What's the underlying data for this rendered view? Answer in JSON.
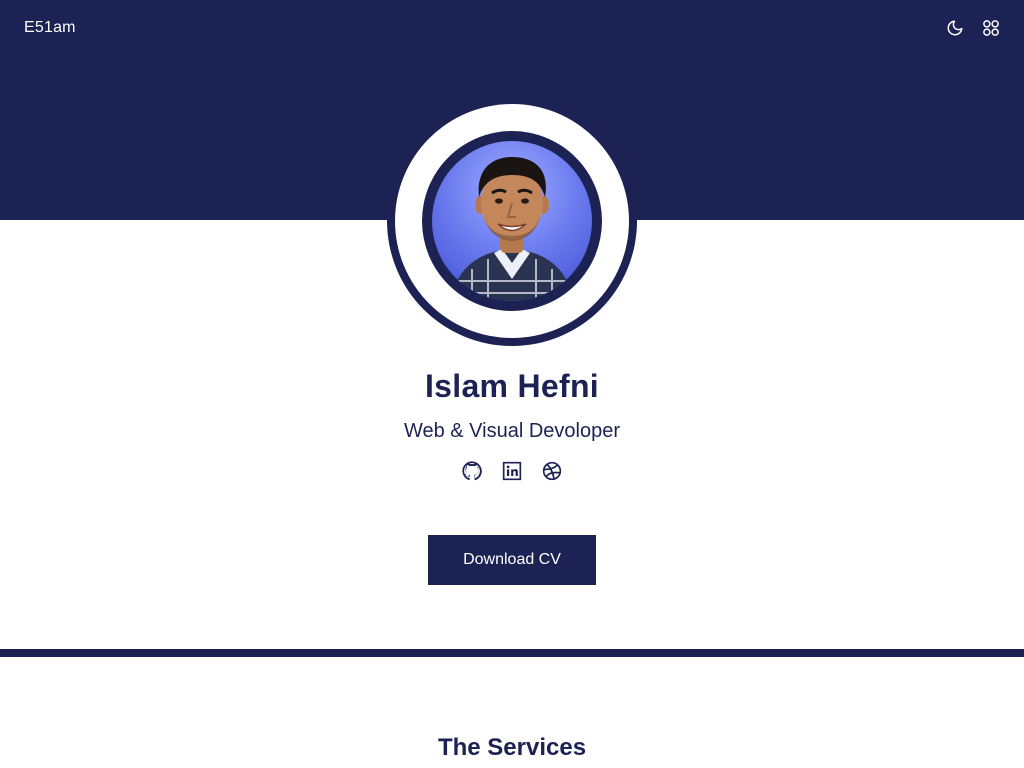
{
  "nav": {
    "logo": "E51am",
    "theme_icon": "moon-icon",
    "menu_icon": "grid-icon"
  },
  "profile": {
    "name": "Islam Hefni",
    "role": "Web & Visual Devoloper",
    "socials": [
      {
        "icon": "github-icon"
      },
      {
        "icon": "linkedin-icon"
      },
      {
        "icon": "dribbble-icon"
      }
    ],
    "cv_label": "Download CV"
  },
  "services": {
    "title": "The Services"
  },
  "colors": {
    "primary": "#1c2254",
    "background": "#ffffff",
    "avatar_bg": "#6d7ef0"
  }
}
